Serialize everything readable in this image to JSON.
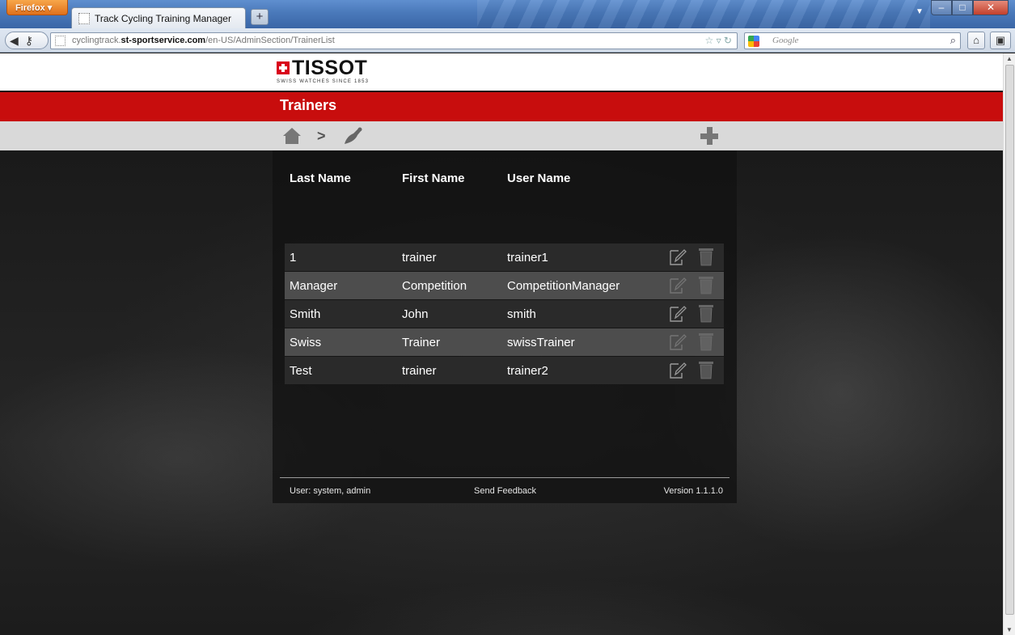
{
  "browser": {
    "app_button": "Firefox",
    "tab_title": "Track Cycling Training Manager",
    "new_tab": "+",
    "url_prefix": "cyclingtrack.",
    "url_domain": "st-sportservice.com",
    "url_path": "/en-US/AdminSection/TrainerList",
    "search_placeholder": "Google"
  },
  "header": {
    "brand": "TISSOT",
    "tagline": "SWISS WATCHES SINCE 1853",
    "page_title": "Trainers"
  },
  "breadcrumb": {
    "separator": ">",
    "icons": [
      "home-icon",
      "trainer-icon"
    ],
    "add_icon": "add-icon"
  },
  "table": {
    "headers": [
      "Last Name",
      "First Name",
      "User Name"
    ],
    "rows": [
      {
        "last": "1",
        "first": "trainer",
        "user": "trainer1",
        "actions_enabled": true
      },
      {
        "last": "Manager",
        "first": "Competition",
        "user": "CompetitionManager",
        "actions_enabled": false
      },
      {
        "last": "Smith",
        "first": "John",
        "user": "smith",
        "actions_enabled": true
      },
      {
        "last": "Swiss",
        "first": "Trainer",
        "user": "swissTrainer",
        "actions_enabled": false
      },
      {
        "last": "Test",
        "first": "trainer",
        "user": "trainer2",
        "actions_enabled": true
      }
    ]
  },
  "footer": {
    "user": "User: system, admin",
    "feedback": "Send Feedback",
    "version": "Version 1.1.1.0"
  },
  "colors": {
    "brand_red": "#c80d0d",
    "row_dark": "#2a2a2a",
    "row_light": "#4d4d4d"
  }
}
